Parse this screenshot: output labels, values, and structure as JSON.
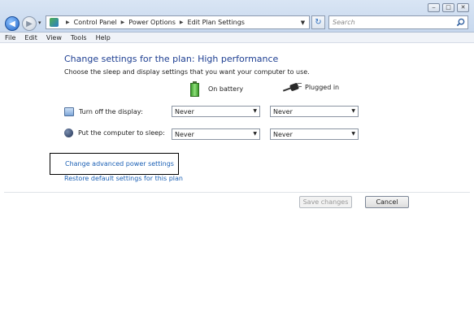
{
  "window": {
    "minimize": "‒",
    "maximize": "□",
    "close": "✕"
  },
  "address": {
    "breadcrumbs": [
      "Control Panel",
      "Power Options",
      "Edit Plan Settings"
    ],
    "search_placeholder": "Search"
  },
  "menu": [
    "File",
    "Edit",
    "View",
    "Tools",
    "Help"
  ],
  "plan": {
    "title": "Change settings for the plan: High performance",
    "description": "Choose the sleep and display settings that you want your computer to use.",
    "columns": {
      "battery": "On battery",
      "plugged": "Plugged in"
    },
    "settings": [
      {
        "label": "Turn off the display:",
        "icon": "monitor-icon",
        "battery": "Never",
        "plugged": "Never"
      },
      {
        "label": "Put the computer to sleep:",
        "icon": "moon-icon",
        "battery": "Never",
        "plugged": "Never"
      }
    ]
  },
  "links": {
    "advanced": "Change advanced power settings",
    "restore": "Restore default settings for this plan"
  },
  "buttons": {
    "save": "Save changes",
    "cancel": "Cancel"
  }
}
